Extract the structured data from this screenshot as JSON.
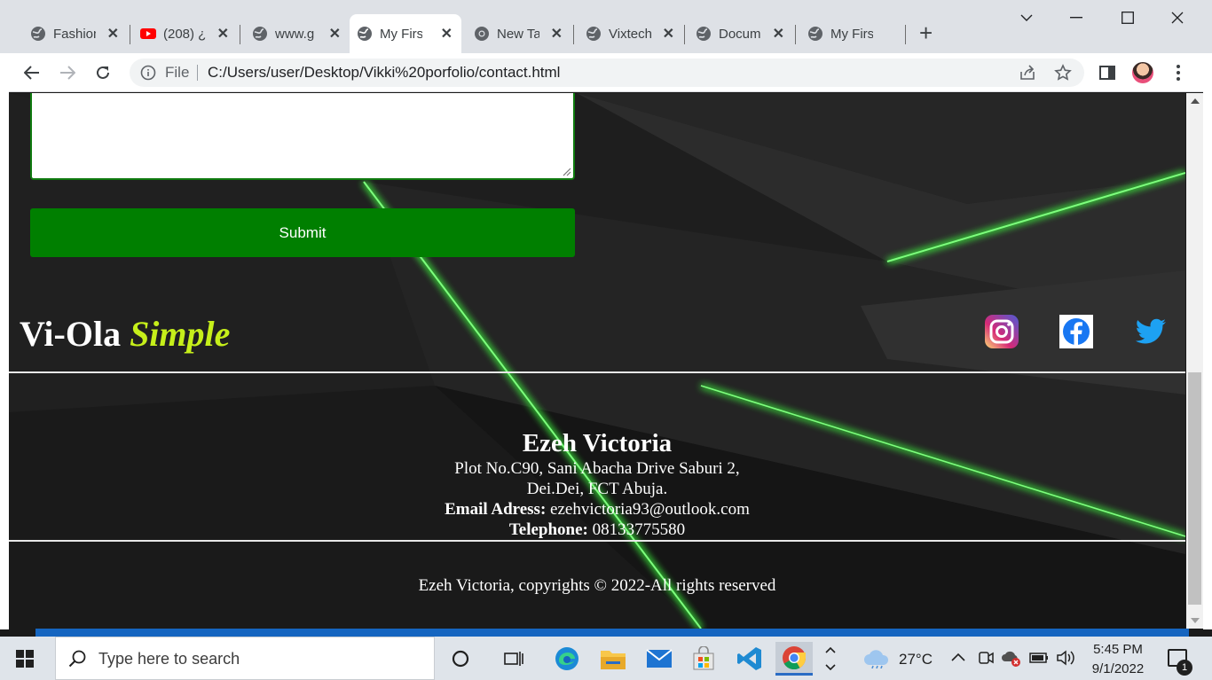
{
  "browser": {
    "tabs": [
      {
        "title": "Fashion",
        "icon": "globe-icon",
        "active": false
      },
      {
        "title": "(208) ¿",
        "icon": "youtube-icon",
        "active": false
      },
      {
        "title": "www.g",
        "icon": "globe-icon",
        "active": false
      },
      {
        "title": "My Firs",
        "icon": "globe-icon",
        "active": true
      },
      {
        "title": "New Ta",
        "icon": "chrome-icon",
        "active": false
      },
      {
        "title": "Vixtech",
        "icon": "globe-icon",
        "active": false
      },
      {
        "title": "Docum",
        "icon": "globe-icon",
        "active": false
      },
      {
        "title": "My Firs",
        "icon": "globe-icon",
        "active": false
      }
    ],
    "address": {
      "scheme_label": "File",
      "url": "C:/Users/user/Desktop/Vikki%20porfolio/contact.html"
    }
  },
  "page": {
    "submit_label": "Submit",
    "brand": {
      "main": "Vi-Ola",
      "accent": "Simple"
    },
    "social": [
      "instagram-icon",
      "facebook-icon",
      "twitter-icon"
    ],
    "contact": {
      "name": "Ezeh Victoria",
      "address_line1": "Plot No.C90, Sani Abacha Drive Saburi 2,",
      "address_line2": "Dei.Dei, FCT Abuja.",
      "email_label": "Email Adress:",
      "email": "ezehvictoria93@outlook.com",
      "phone_label": "Telephone:",
      "phone": "08133775580"
    },
    "copyright": "Ezeh Victoria, copyrights © 2022-All rights reserved",
    "colors": {
      "accent_green": "#007f00",
      "brand_accent": "#c6ef1a",
      "glow": "#3cff3c"
    }
  },
  "taskbar": {
    "search_placeholder": "Type here to search",
    "weather": "27°C",
    "time": "5:45 PM",
    "date": "9/1/2022",
    "notification_count": "1"
  }
}
